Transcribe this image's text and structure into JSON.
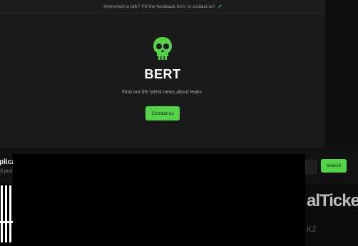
{
  "banner": {
    "text": "Interested to talk? Fill the feedback form to contact us!",
    "arrow": "↗"
  },
  "hero": {
    "icon": "skull-icon",
    "title": "BERT",
    "subtitle": "Find out the latest news about leaks.",
    "contact_label": "Contact us"
  },
  "posts": {
    "title": "plica",
    "count": "3 pos"
  },
  "search": {
    "button_label": "Search",
    "placeholder": ""
  },
  "thumbnail_right": {
    "brand_text": "alTicket",
    "tag_text": "K2"
  },
  "colors": {
    "accent": "#54d34a",
    "background": "#161616",
    "hero_bg": "#1a1a1a"
  }
}
